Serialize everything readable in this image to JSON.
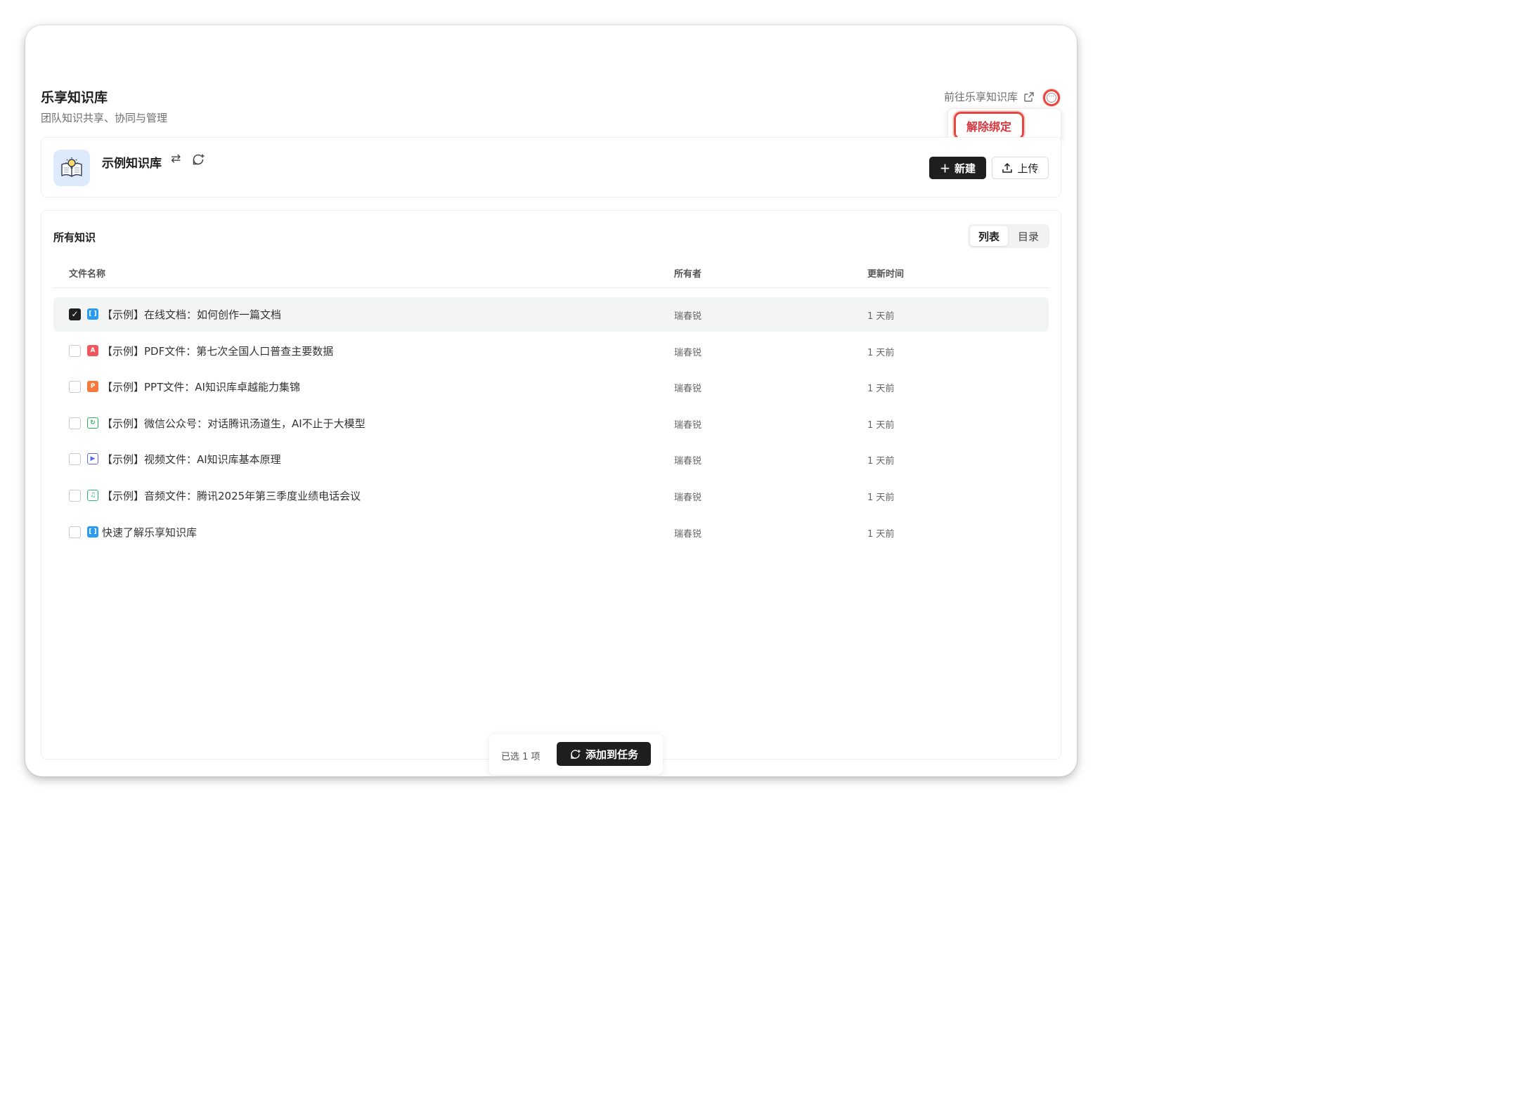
{
  "header": {
    "title": "乐享知识库",
    "subtitle": "团队知识共享、协同与管理",
    "goto_label": "前往乐享知识库",
    "more_icon": "more-icon"
  },
  "menu": {
    "unbind_label": "解除绑定"
  },
  "kb": {
    "name": "示例知识库",
    "swap_icon": "⇄",
    "new_label": "新建",
    "upload_label": "上传"
  },
  "list": {
    "title": "所有知识",
    "views": [
      "列表",
      "目录"
    ],
    "active_view": "列表",
    "columns": {
      "name": "文件名称",
      "owner": "所有者",
      "time": "更新时间"
    },
    "rows": [
      {
        "name": "【示例】在线文档：如何创作一篇文档",
        "owner": "瑞春锐",
        "time": "1 天前",
        "type": "doc",
        "checked": true
      },
      {
        "name": "【示例】PDF文件：第七次全国人口普查主要数据",
        "owner": "瑞春锐",
        "time": "1 天前",
        "type": "pdf",
        "checked": false
      },
      {
        "name": "【示例】PPT文件：AI知识库卓越能力集锦",
        "owner": "瑞春锐",
        "time": "1 天前",
        "type": "ppt",
        "checked": false
      },
      {
        "name": "【示例】微信公众号：对话腾讯汤道生，AI不止于大模型",
        "owner": "瑞春锐",
        "time": "1 天前",
        "type": "wechat",
        "checked": false
      },
      {
        "name": "【示例】视频文件：AI知识库基本原理",
        "owner": "瑞春锐",
        "time": "1 天前",
        "type": "video",
        "checked": false
      },
      {
        "name": "【示例】音频文件：腾讯2025年第三季度业绩电话会议",
        "owner": "瑞春锐",
        "time": "1 天前",
        "type": "audio",
        "checked": false
      },
      {
        "name": "快速了解乐享知识库",
        "owner": "瑞春锐",
        "time": "1 天前",
        "type": "doc",
        "checked": false
      }
    ]
  },
  "selection": {
    "count_label": "已选 1 项",
    "add_task_label": "添加到任务"
  },
  "colors": {
    "accent_red": "#e5483f",
    "primary_dark": "#1f1f1f",
    "doc": "#2b9af3",
    "pdf": "#f0565c",
    "ppt": "#f5793a",
    "wechat": "#27b45a",
    "video": "#5b6cf0",
    "audio": "#2bb673"
  }
}
